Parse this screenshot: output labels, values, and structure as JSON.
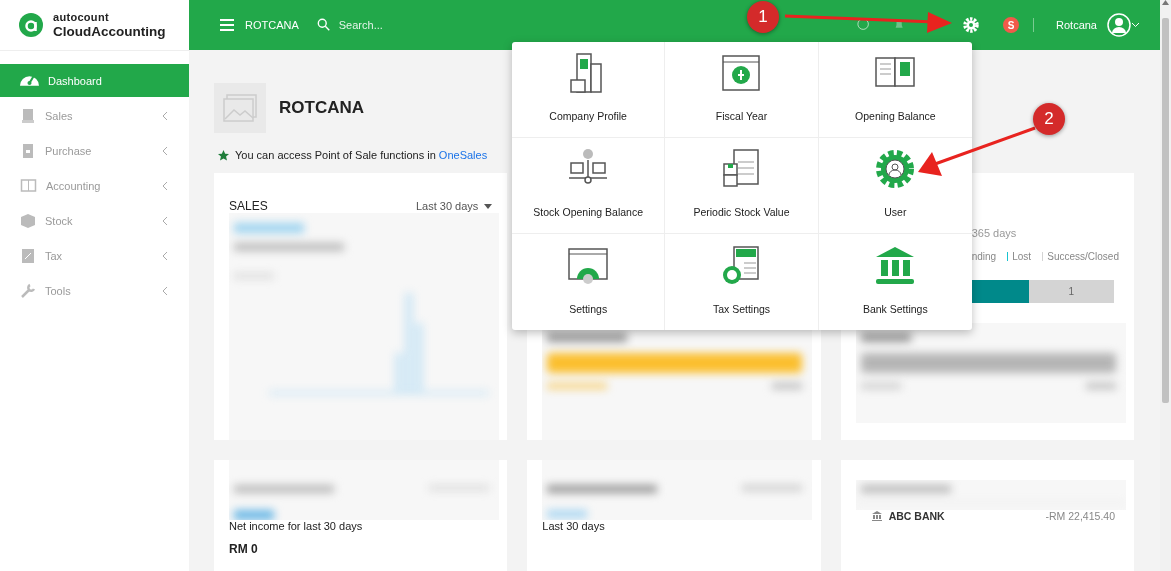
{
  "sidebar": {
    "logo": {
      "brand": "autocount",
      "product": "CloudAccounting"
    },
    "items": [
      {
        "label": "Dashboard",
        "selected": true,
        "expandable": false
      },
      {
        "label": "Sales",
        "selected": false,
        "expandable": true
      },
      {
        "label": "Purchase",
        "selected": false,
        "expandable": true
      },
      {
        "label": "Accounting",
        "selected": false,
        "expandable": true
      },
      {
        "label": "Stock",
        "selected": false,
        "expandable": true
      },
      {
        "label": "Tax",
        "selected": false,
        "expandable": true
      },
      {
        "label": "Tools",
        "selected": false,
        "expandable": true
      }
    ]
  },
  "header": {
    "company": "ROTCANA",
    "search_placeholder": "Search...",
    "badge": "S",
    "user": "Rotcana"
  },
  "dashboard": {
    "company_name": "ROTCANA",
    "notice": {
      "text": "You can access Point of Sale functions in",
      "link": "OneSales"
    },
    "sales_card": {
      "title": "SALES",
      "period": "Last 30 days"
    },
    "opportunity_card": {
      "period": "365 days",
      "legend": [
        {
          "label": "nding"
        },
        {
          "label": "Lost",
          "color": "#17c3d0"
        },
        {
          "label": "Success/Closed",
          "color": "#d4d4d4"
        }
      ],
      "bar": [
        {
          "color": "#00898a"
        },
        {
          "color": "#d4d4d4",
          "value": "1"
        }
      ]
    },
    "income_card": {
      "caption": "Net income for last 30 days",
      "value": "RM 0"
    },
    "second_card": {
      "caption": "Last 30 days"
    },
    "bank_card": {
      "bank": "ABC BANK",
      "amount": "-RM 22,415.40"
    }
  },
  "settings_menu": {
    "items": [
      {
        "label": "Company Profile"
      },
      {
        "label": "Fiscal Year"
      },
      {
        "label": "Opening Balance"
      },
      {
        "label": "Stock Opening Balance"
      },
      {
        "label": "Periodic Stock Value"
      },
      {
        "label": "User"
      },
      {
        "label": "Settings"
      },
      {
        "label": "Tax Settings"
      },
      {
        "label": "Bank Settings"
      }
    ]
  },
  "annotations": [
    {
      "number": "1"
    },
    {
      "number": "2"
    }
  ]
}
